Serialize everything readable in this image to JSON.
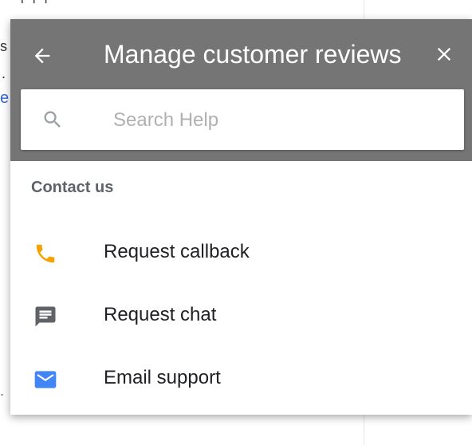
{
  "header": {
    "title": "Manage customer reviews",
    "back_icon": "arrow-left-icon",
    "close_icon": "close-icon",
    "background_color": "#757575"
  },
  "search": {
    "placeholder": "Search Help",
    "value": "",
    "icon": "search-icon"
  },
  "contact": {
    "section_title": "Contact us",
    "options": [
      {
        "label": "Request callback",
        "icon": "phone-icon",
        "icon_color": "#f4a300"
      },
      {
        "label": "Request chat",
        "icon": "chat-icon",
        "icon_color": "#5f6368"
      },
      {
        "label": "Email support",
        "icon": "email-icon",
        "icon_color": "#4285f4"
      }
    ]
  }
}
